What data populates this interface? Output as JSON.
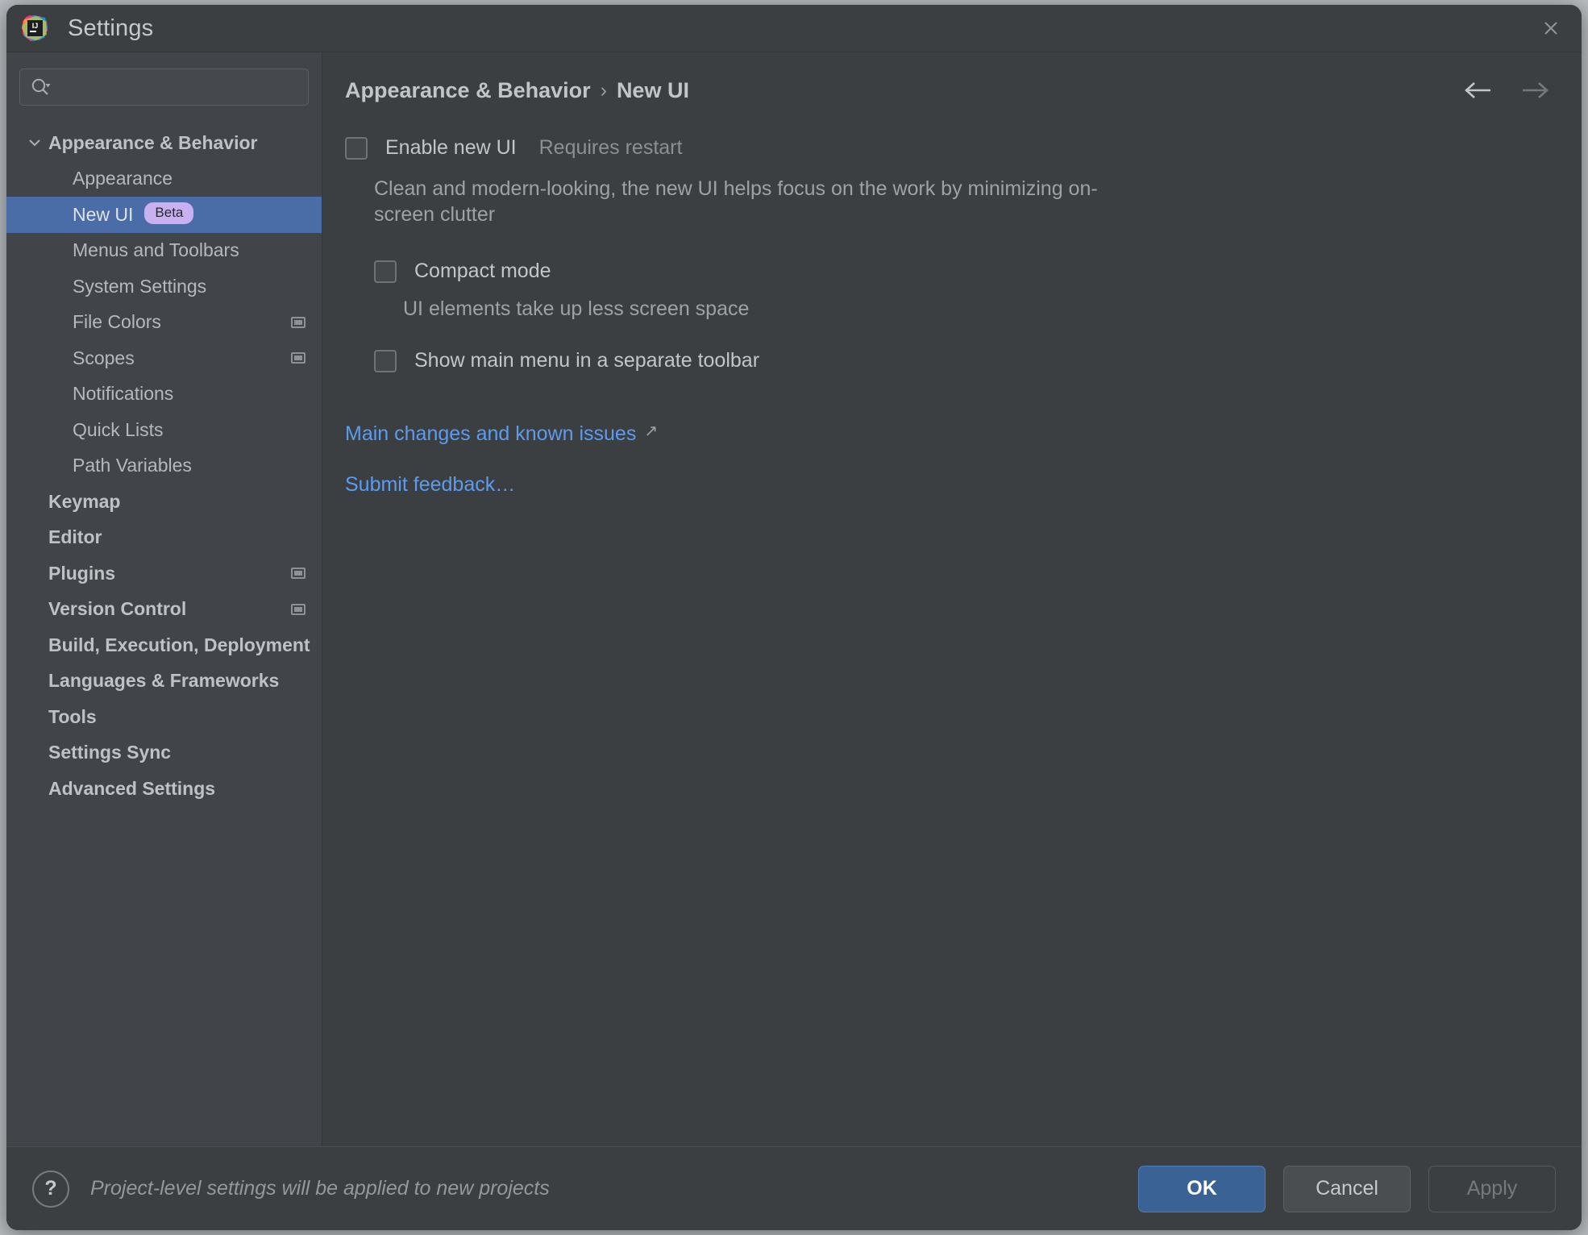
{
  "window": {
    "title": "Settings",
    "app_icon": "intellij-idea-logo",
    "close_icon": "close-icon"
  },
  "search": {
    "icon": "search-icon",
    "value": "",
    "placeholder": ""
  },
  "sidebar": {
    "items": [
      {
        "label": "Appearance & Behavior",
        "level": 0,
        "bold": true,
        "twisty": "down",
        "selected": false,
        "badge": null,
        "project_icon": false
      },
      {
        "label": "Appearance",
        "level": 1,
        "bold": false,
        "twisty": null,
        "selected": false,
        "badge": null,
        "project_icon": false
      },
      {
        "label": "New UI",
        "level": 1,
        "bold": false,
        "twisty": null,
        "selected": true,
        "badge": "Beta",
        "project_icon": false
      },
      {
        "label": "Menus and Toolbars",
        "level": 1,
        "bold": false,
        "twisty": null,
        "selected": false,
        "badge": null,
        "project_icon": false
      },
      {
        "label": "System Settings",
        "level": 1,
        "bold": false,
        "twisty": "right",
        "selected": false,
        "badge": null,
        "project_icon": false
      },
      {
        "label": "File Colors",
        "level": 1,
        "bold": false,
        "twisty": null,
        "selected": false,
        "badge": null,
        "project_icon": true
      },
      {
        "label": "Scopes",
        "level": 1,
        "bold": false,
        "twisty": null,
        "selected": false,
        "badge": null,
        "project_icon": true
      },
      {
        "label": "Notifications",
        "level": 1,
        "bold": false,
        "twisty": null,
        "selected": false,
        "badge": null,
        "project_icon": false
      },
      {
        "label": "Quick Lists",
        "level": 1,
        "bold": false,
        "twisty": null,
        "selected": false,
        "badge": null,
        "project_icon": false
      },
      {
        "label": "Path Variables",
        "level": 1,
        "bold": false,
        "twisty": null,
        "selected": false,
        "badge": null,
        "project_icon": false
      },
      {
        "label": "Keymap",
        "level": 0,
        "bold": true,
        "twisty": null,
        "selected": false,
        "badge": null,
        "project_icon": false
      },
      {
        "label": "Editor",
        "level": 0,
        "bold": true,
        "twisty": "right",
        "selected": false,
        "badge": null,
        "project_icon": false
      },
      {
        "label": "Plugins",
        "level": 0,
        "bold": true,
        "twisty": null,
        "selected": false,
        "badge": null,
        "project_icon": true
      },
      {
        "label": "Version Control",
        "level": 0,
        "bold": true,
        "twisty": "right",
        "selected": false,
        "badge": null,
        "project_icon": true
      },
      {
        "label": "Build, Execution, Deployment",
        "level": 0,
        "bold": true,
        "twisty": "right",
        "selected": false,
        "badge": null,
        "project_icon": false
      },
      {
        "label": "Languages & Frameworks",
        "level": 0,
        "bold": true,
        "twisty": "right",
        "selected": false,
        "badge": null,
        "project_icon": false
      },
      {
        "label": "Tools",
        "level": 0,
        "bold": true,
        "twisty": "right",
        "selected": false,
        "badge": null,
        "project_icon": false
      },
      {
        "label": "Settings Sync",
        "level": 0,
        "bold": true,
        "twisty": null,
        "selected": false,
        "badge": null,
        "project_icon": false
      },
      {
        "label": "Advanced Settings",
        "level": 0,
        "bold": true,
        "twisty": null,
        "selected": false,
        "badge": null,
        "project_icon": false
      }
    ]
  },
  "main": {
    "breadcrumb": {
      "parent": "Appearance & Behavior",
      "separator": "›",
      "current": "New UI"
    },
    "nav": {
      "back_icon": "arrow-left-icon",
      "forward_icon": "arrow-right-icon"
    },
    "enable_new_ui": {
      "label": "Enable new UI",
      "note": "Requires restart",
      "checked": false,
      "description": "Clean and modern-looking, the new UI helps focus on the work by minimizing on-screen clutter"
    },
    "compact_mode": {
      "label": "Compact mode",
      "checked": false,
      "description": "UI elements take up less screen space"
    },
    "separate_toolbar": {
      "label": "Show main menu in a separate toolbar",
      "checked": false
    },
    "links": [
      {
        "label": "Main changes and known issues",
        "external": true
      },
      {
        "label": "Submit feedback…",
        "external": false
      }
    ]
  },
  "footer": {
    "help_icon": "question-mark-icon",
    "note": "Project-level settings will be applied to new projects",
    "ok_label": "OK",
    "cancel_label": "Cancel",
    "apply_label": "Apply"
  },
  "colors": {
    "accent_blue": "#4a6da7",
    "link_blue": "#5b9bf0",
    "badge_purple": "#c9b0f0",
    "primary_button": "#3a6294",
    "window_bg": "#3c3f41",
    "sidebar_bg": "#41454a"
  }
}
